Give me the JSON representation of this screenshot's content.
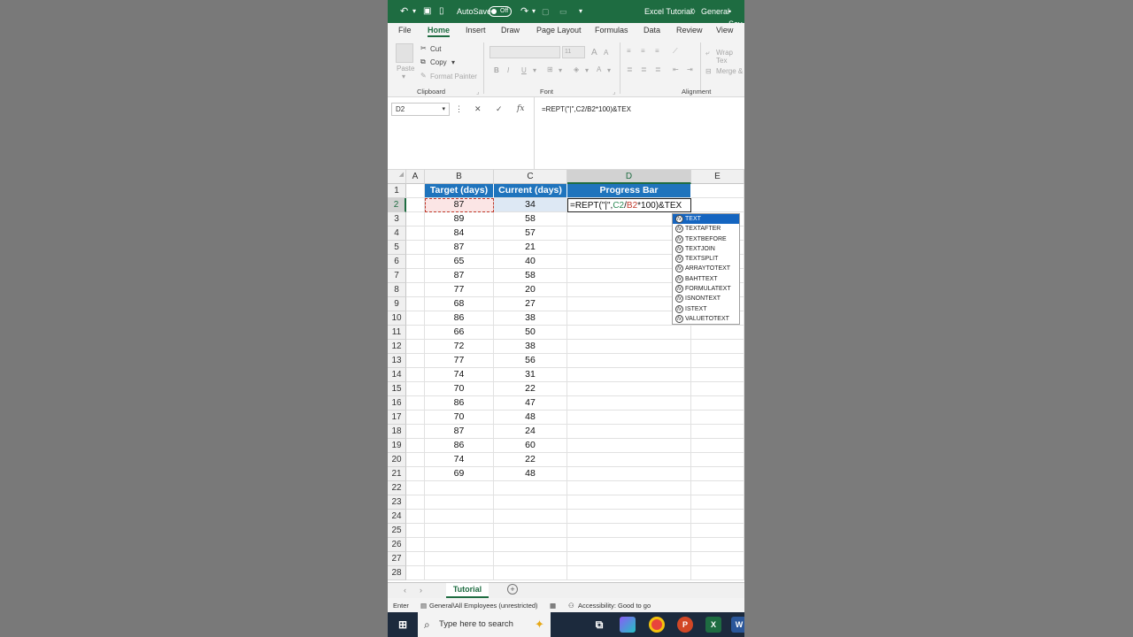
{
  "titlebar": {
    "autosave_label": "AutoSave",
    "autosave_state": "Off",
    "file_name": "Excel Tutorial",
    "sensitivity": "General",
    "save_status": "Sav"
  },
  "ribbon": {
    "tabs": [
      "File",
      "Home",
      "Insert",
      "Draw",
      "Page Layout",
      "Formulas",
      "Data",
      "Review",
      "View"
    ],
    "paste": "Paste",
    "cut": "Cut",
    "copy": "Copy",
    "format_painter": "Format Painter",
    "clipboard_group": "Clipboard",
    "font_group": "Font",
    "alignment_group": "Alignment",
    "font_size": "11",
    "wrap_text": "Wrap Tex",
    "merge": "Merge &",
    "bold": "B",
    "italic": "I",
    "underline": "U"
  },
  "formula_bar": {
    "name_box": "D2",
    "formula": "=REPT(\"|\",C2/B2*100)&TEX"
  },
  "columns": [
    "A",
    "B",
    "C",
    "D",
    "E"
  ],
  "rows": [
    "1",
    "2",
    "3",
    "4",
    "5",
    "6",
    "7",
    "8",
    "9",
    "10",
    "11",
    "12",
    "13",
    "14",
    "15",
    "16",
    "17",
    "18",
    "19",
    "20",
    "21",
    "22",
    "23",
    "24",
    "25",
    "26",
    "27",
    "28"
  ],
  "table": {
    "headers": [
      "Target (days)",
      "Current (days)",
      "Progress Bar"
    ],
    "target": [
      87,
      89,
      84,
      87,
      65,
      87,
      77,
      68,
      86,
      66,
      72,
      77,
      74,
      70,
      86,
      70,
      87,
      86,
      74,
      69
    ],
    "current": [
      34,
      58,
      57,
      21,
      40,
      58,
      20,
      27,
      38,
      50,
      38,
      56,
      31,
      22,
      47,
      48,
      24,
      60,
      22,
      48
    ]
  },
  "edit_cell": {
    "p1": "=REPT(\"|\",",
    "p2": "C2",
    "p3": "/",
    "p4": "B2",
    "p5": "*100)&TEX"
  },
  "autocomplete": [
    "TEXT",
    "TEXTAFTER",
    "TEXTBEFORE",
    "TEXTJOIN",
    "TEXTSPLIT",
    "ARRAYTOTEXT",
    "BAHTTEXT",
    "FORMULATEXT",
    "ISNONTEXT",
    "ISTEXT",
    "VALUETOTEXT"
  ],
  "sheet_tab": "Tutorial",
  "status": {
    "mode": "Enter",
    "sensitivity": "General\\All Employees (unrestricted)",
    "accessibility": "Accessibility: Good to go"
  },
  "taskbar": {
    "search_placeholder": "Type here to search"
  }
}
